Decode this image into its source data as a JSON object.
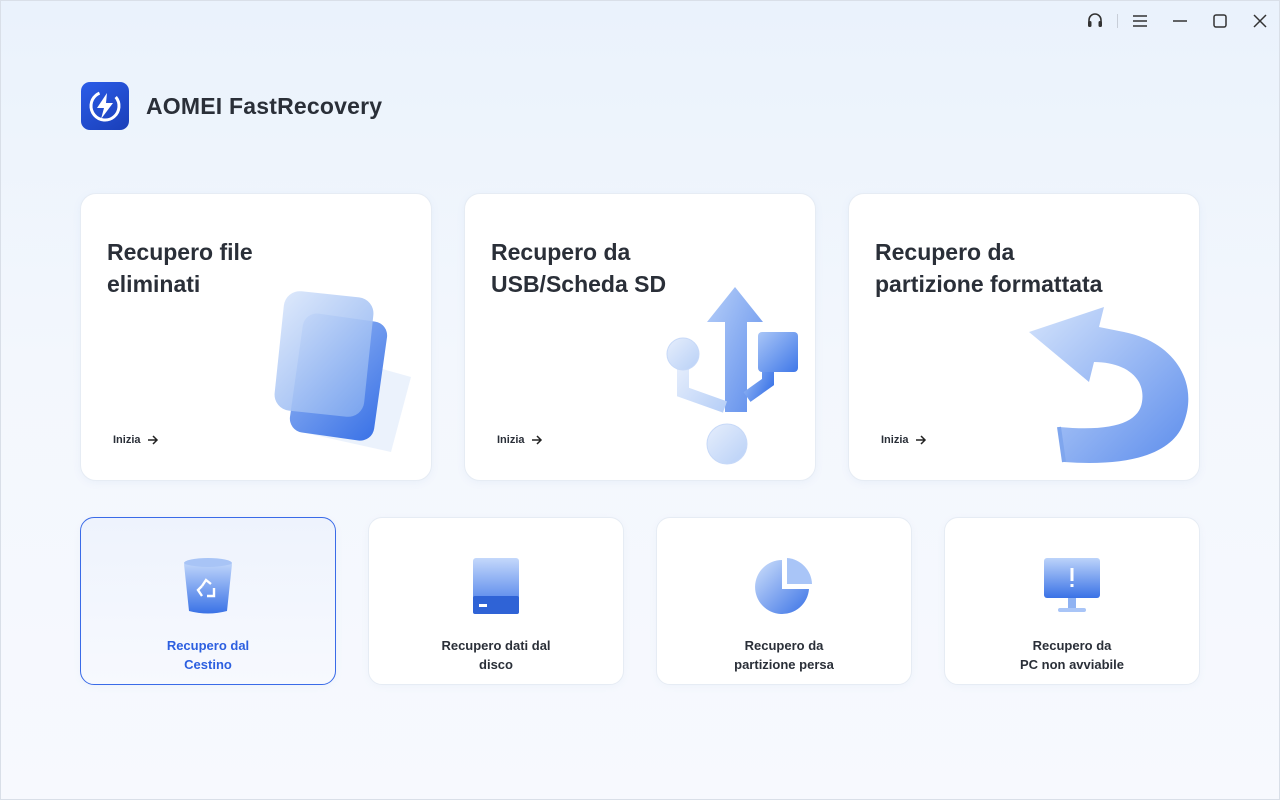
{
  "window": {
    "controls": [
      "support-icon",
      "menu-icon",
      "minimize-icon",
      "maximize-icon",
      "close-icon"
    ]
  },
  "app": {
    "title": "AOMEI FastRecovery"
  },
  "big_cards": [
    {
      "title_line1": "Recupero file",
      "title_line2": "eliminati",
      "action": "Inizia"
    },
    {
      "title_line1": "Recupero da",
      "title_line2": "USB/Scheda SD",
      "action": "Inizia"
    },
    {
      "title_line1": "Recupero da",
      "title_line2": "partizione formattata",
      "action": "Inizia"
    }
  ],
  "small_cards": [
    {
      "line1": "Recupero dal",
      "line2": "Cestino",
      "selected": true
    },
    {
      "line1": "Recupero dati dal",
      "line2": "disco",
      "selected": false
    },
    {
      "line1": "Recupero da",
      "line2": "partizione persa",
      "selected": false
    },
    {
      "line1": "Recupero da",
      "line2": "PC non avviabile",
      "selected": false
    }
  ],
  "colors": {
    "accent": "#2c5fe0",
    "text": "#2a2f38"
  }
}
